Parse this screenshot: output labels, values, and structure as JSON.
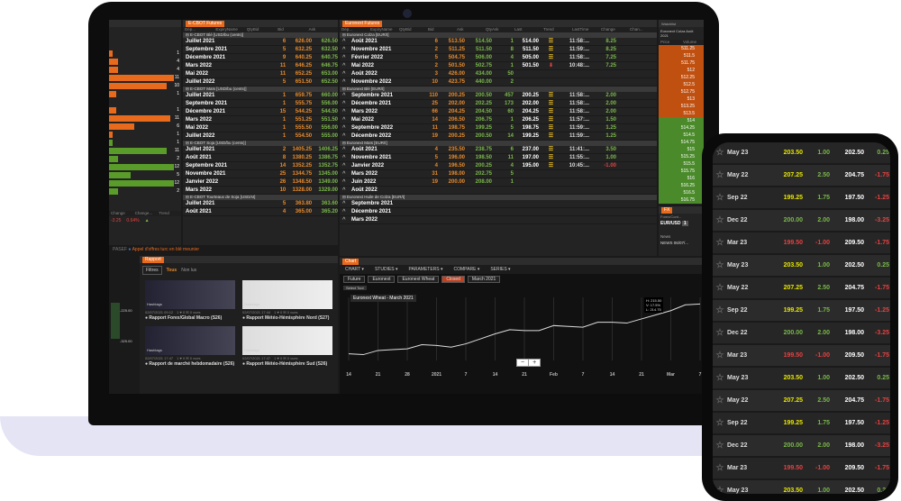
{
  "left_panel": {
    "bars": [
      {
        "value": "1",
        "fill": 0.05,
        "color": "#e86a1c"
      },
      {
        "value": "4",
        "fill": 0.12,
        "color": "#e86a1c"
      },
      {
        "value": "4",
        "fill": 0.12,
        "color": "#e86a1c"
      },
      {
        "value": "11",
        "fill": 0.9,
        "color": "#e86a1c"
      },
      {
        "value": "10",
        "fill": 0.8,
        "color": "#e86a1c"
      },
      {
        "value": "1",
        "fill": 0.1,
        "color": "#e86a1c"
      },
      {
        "value": "",
        "fill": 0,
        "color": "#e86a1c"
      },
      {
        "value": "1",
        "fill": 0.1,
        "color": "#e86a1c"
      },
      {
        "value": "11",
        "fill": 0.85,
        "color": "#e86a1c"
      },
      {
        "value": "6",
        "fill": 0.35,
        "color": "#e86a1c"
      },
      {
        "value": "1",
        "fill": 0.05,
        "color": "#e86a1c"
      },
      {
        "value": "1",
        "fill": 0.05,
        "color": "#5a9c2a"
      },
      {
        "value": "11",
        "fill": 0.8,
        "color": "#5a9c2a"
      },
      {
        "value": "2",
        "fill": 0.12,
        "color": "#5a9c2a"
      },
      {
        "value": "12",
        "fill": 0.9,
        "color": "#5a9c2a"
      },
      {
        "value": "5",
        "fill": 0.3,
        "color": "#5a9c2a"
      },
      {
        "value": "12",
        "fill": 0.9,
        "color": "#5a9c2a"
      },
      {
        "value": "2",
        "fill": 0.12,
        "color": "#5a9c2a"
      }
    ],
    "footer_headers": [
      "Change",
      "Change...",
      "Trend"
    ],
    "footer_values": [
      "-3.25",
      "0.64%"
    ]
  },
  "cbot": {
    "tab": "E-CBOT Futures",
    "headers": [
      "Dép...",
      "ExpiryName",
      "QtyBid",
      "Bid",
      "Ask"
    ],
    "sections": [
      {
        "title": "E-CBOT Blé [USD/bu (cents)]",
        "rows": [
          [
            "Juillet 2021",
            "6",
            "626.00",
            "626.50"
          ],
          [
            "Septembre 2021",
            "5",
            "632.25",
            "632.50"
          ],
          [
            "Décembre 2021",
            "9",
            "640.25",
            "640.75"
          ],
          [
            "Mars 2022",
            "11",
            "646.25",
            "646.75"
          ],
          [
            "Mai 2022",
            "11",
            "652.25",
            "653.00"
          ],
          [
            "Juillet 2022",
            "5",
            "651.50",
            "652.50"
          ]
        ]
      },
      {
        "title": "E-CBOT Maïs [USD/bu (cents)]",
        "rows": [
          [
            "Juillet 2021",
            "1",
            "659.75",
            "660.00"
          ],
          [
            "Septembre 2021",
            "1",
            "555.75",
            "556.00"
          ],
          [
            "Décembre 2021",
            "15",
            "544.25",
            "544.50"
          ],
          [
            "Mars 2022",
            "1",
            "551.25",
            "551.50"
          ],
          [
            "Mai 2022",
            "1",
            "555.50",
            "556.00"
          ],
          [
            "Juillet 2022",
            "1",
            "554.50",
            "555.00"
          ]
        ]
      },
      {
        "title": "E-CBOT Soja [USD/bu (cents)]",
        "rows": [
          [
            "Juillet 2021",
            "2",
            "1405.25",
            "1406.25"
          ],
          [
            "Août 2021",
            "8",
            "1380.25",
            "1386.75"
          ],
          [
            "Septembre 2021",
            "14",
            "1352.25",
            "1352.75"
          ],
          [
            "Novembre 2021",
            "25",
            "1344.75",
            "1345.00"
          ],
          [
            "Janvier 2022",
            "26",
            "1348.50",
            "1349.00"
          ],
          [
            "Mars 2022",
            "10",
            "1328.00",
            "1329.00"
          ]
        ]
      },
      {
        "title": "E-CBOT Tourteaux de Soja [USD/st]",
        "rows": [
          [
            "Juillet 2021",
            "5",
            "363.80",
            "363.60"
          ],
          [
            "Août 2021",
            "4",
            "365.00",
            "365.20"
          ]
        ]
      }
    ]
  },
  "euronext": {
    "tab": "Euronext Futures",
    "headers": [
      "Dép...",
      "ExpiryName",
      "QtyBid",
      "Bid",
      "Ask",
      "QtyAsk",
      "Last",
      "Trend",
      "LastTime",
      "Change",
      "Chan..."
    ],
    "sections": [
      {
        "title": "Euronext Colza [EUR/t]",
        "rows": [
          [
            "Août 2021",
            "6",
            "513.50",
            "514.50",
            "1",
            "514.00",
            "up",
            "11:58:...",
            "8.25",
            "1"
          ],
          [
            "Novembre 2021",
            "2",
            "511.25",
            "511.50",
            "8",
            "511.50",
            "up",
            "11:59:...",
            "8.25",
            "1"
          ],
          [
            "Février 2022",
            "5",
            "504.75",
            "506.00",
            "4",
            "505.00",
            "up",
            "11:58:...",
            "7.25",
            "1"
          ],
          [
            "Mai 2022",
            "2",
            "501.50",
            "502.75",
            "1",
            "501.50",
            "down",
            "10:48:...",
            "7.25",
            "1"
          ],
          [
            "Août 2022",
            "3",
            "426.00",
            "434.00",
            "50",
            "",
            "",
            "",
            "",
            ""
          ],
          [
            "Novembre 2022",
            "10",
            "423.75",
            "440.00",
            "2",
            "",
            "",
            "",
            "",
            ""
          ]
        ]
      },
      {
        "title": "Euronext Blé [EUR/t]",
        "rows": [
          [
            "Septembre 2021",
            "110",
            "200.25",
            "200.50",
            "457",
            "200.25",
            "up",
            "11:58:...",
            "2.00",
            "0"
          ],
          [
            "Décembre 2021",
            "25",
            "202.00",
            "202.25",
            "173",
            "202.00",
            "up",
            "11:58:...",
            "2.00",
            "0"
          ],
          [
            "Mars 2022",
            "66",
            "204.25",
            "204.50",
            "60",
            "204.25",
            "up",
            "11:58:...",
            "2.00",
            "0"
          ],
          [
            "Mai 2022",
            "14",
            "206.50",
            "206.75",
            "1",
            "206.25",
            "up",
            "11:57:...",
            "1.50",
            "0"
          ],
          [
            "Septembre 2022",
            "11",
            "198.75",
            "199.25",
            "5",
            "198.75",
            "up",
            "11:59:...",
            "1.25",
            "0"
          ],
          [
            "Décembre 2022",
            "19",
            "200.25",
            "200.50",
            "14",
            "199.25",
            "up",
            "11:59:...",
            "1.25",
            "0"
          ]
        ]
      },
      {
        "title": "Euronext Maïs [EUR/t]",
        "rows": [
          [
            "Août 2021",
            "4",
            "235.50",
            "238.75",
            "6",
            "237.00",
            "up",
            "11:41:...",
            "3.50",
            "1"
          ],
          [
            "Novembre 2021",
            "5",
            "196.00",
            "198.50",
            "11",
            "197.00",
            "up",
            "11:55:...",
            "1.00",
            "0"
          ],
          [
            "Janvier 2022",
            "4",
            "196.50",
            "200.25",
            "4",
            "195.00",
            "up",
            "10:45:...",
            "-1.00",
            "0"
          ],
          [
            "Mars 2022",
            "31",
            "198.00",
            "202.75",
            "5",
            "",
            "",
            "",
            "",
            ""
          ],
          [
            "Juin 2022",
            "19",
            "200.00",
            "208.00",
            "1",
            "",
            "",
            "",
            "",
            ""
          ],
          [
            "Août 2022",
            "",
            "",
            "",
            "",
            "",
            "",
            "",
            "",
            ""
          ]
        ]
      },
      {
        "title": "Euronext Huile de Colza [EUR/t]",
        "rows": [
          [
            "Septembre 2021",
            "",
            "",
            "",
            "",
            "",
            "",
            "",
            "",
            ""
          ],
          [
            "Décembre 2021",
            "",
            "",
            "",
            "",
            "",
            "",
            "",
            "",
            ""
          ],
          [
            "Mars 2022",
            "",
            "",
            "",
            "",
            "",
            "",
            "",
            "",
            ""
          ]
        ]
      }
    ]
  },
  "ladder": {
    "title": "Euronext Colza Août 2021",
    "headers": [
      "Price",
      "Volume"
    ],
    "ask": [
      "511.25",
      "511.5",
      "511.75",
      "512",
      "512.25",
      "512.5",
      "512.75",
      "513",
      "513.25",
      "513.5"
    ],
    "bid": [
      "514",
      "514.25",
      "514.5",
      "514.75",
      "515",
      "515.25",
      "515.5",
      "515.75",
      "516",
      "516.25",
      "516.5",
      "516.75"
    ]
  },
  "fx": {
    "tab": "FX",
    "headers": [
      "Forex/Cont...",
      ""
    ],
    "pair": "EUR/USD",
    "value": "1"
  },
  "news": {
    "label": "News",
    "source": "NEWS",
    "date": "06/07/..."
  },
  "ticker": {
    "prefix": "PASEF",
    "text": "Appel d'offres turc en blé meunier"
  },
  "rapport": {
    "tab": "Rapport",
    "filters_label": "Filtres",
    "filter_all": "Tous",
    "filter_unread": "Non lus",
    "cards": [
      {
        "title": "Rapport Forex/Global Macro (S26)",
        "date": "02/07/2021 09:12",
        "stats": "1 ♥ 0 ✉ 0 vues"
      },
      {
        "title": "Rapport Météo-Hémisphère Nord (S27)",
        "date": "02/07/2021 17:44",
        "stats": "1 ♥ 0 ✉ 0 vues"
      },
      {
        "title": "Rapport de marché hebdomadaire (S26)",
        "date": "02/07/2021 17:47",
        "stats": "1 ♥ 0 ✉ 0 vues"
      },
      {
        "title": "Rapport Météo-Hémisphère Sud (S26)",
        "date": "02/07/2021 17:47",
        "stats": "1 ♥ 0 ✉ 0 vues"
      }
    ],
    "tag": "Hashtags"
  },
  "mini_chart": {
    "labels": [
      "-225.00",
      "-325.00"
    ]
  },
  "chart": {
    "tab": "Chart",
    "toolbar": [
      "CHART",
      "STUDIES",
      "PARAMETERS",
      "COMPARE",
      "SERIES"
    ],
    "controls": [
      "Future",
      "Euronext",
      "Euronext Wheat",
      "Closed",
      "March 2021"
    ],
    "select_tool": "Select Tool",
    "series_label": "Euronext Wheat - March 2021",
    "tooltip": [
      "H: 215.50",
      "V: 17.5%",
      "L: 214.75"
    ],
    "x_ticks": [
      "14",
      "21",
      "28",
      "2021",
      "7",
      "14",
      "21",
      "Feb",
      "7",
      "14",
      "21",
      "Mar",
      "7"
    ],
    "zoom_minus": "−",
    "zoom_plus": "+",
    "chart_data": {
      "type": "line",
      "title": "Euronext Wheat - March 2021",
      "x": [
        "14",
        "21",
        "28",
        "2021",
        "7",
        "14",
        "21",
        "Feb",
        "7",
        "14",
        "21",
        "Mar",
        "7"
      ],
      "values": [
        184,
        186,
        187,
        189,
        190,
        196,
        198,
        201,
        200,
        203,
        205,
        210,
        214
      ],
      "ylim": [
        180,
        218
      ]
    }
  },
  "phone": {
    "rows": [
      [
        "May 23",
        "203.50",
        "1.00",
        "202.50",
        "0.25",
        "y",
        "gr",
        "gr"
      ],
      [
        "May 22",
        "207.25",
        "2.50",
        "204.75",
        "-1.75",
        "y",
        "gr",
        "rd"
      ],
      [
        "Sep 22",
        "199.25",
        "1.75",
        "197.50",
        "-1.25",
        "y",
        "gr",
        "rd"
      ],
      [
        "Dec 22",
        "200.00",
        "2.00",
        "198.00",
        "-3.25",
        "gr",
        "gr",
        "rd"
      ],
      [
        "Mar 23",
        "199.50",
        "-1.00",
        "209.50",
        "-1.75",
        "rd",
        "rd",
        "rd"
      ],
      [
        "May 23",
        "203.50",
        "1.00",
        "202.50",
        "0.25",
        "y",
        "gr",
        "gr"
      ],
      [
        "May 22",
        "207.25",
        "2.50",
        "204.75",
        "-1.75",
        "y",
        "gr",
        "rd"
      ],
      [
        "Sep 22",
        "199.25",
        "1.75",
        "197.50",
        "-1.25",
        "y",
        "gr",
        "rd"
      ],
      [
        "Dec 22",
        "200.00",
        "2.00",
        "198.00",
        "-3.25",
        "gr",
        "gr",
        "rd"
      ],
      [
        "Mar 23",
        "199.50",
        "-1.00",
        "209.50",
        "-1.75",
        "rd",
        "rd",
        "rd"
      ],
      [
        "May 23",
        "203.50",
        "1.00",
        "202.50",
        "0.25",
        "y",
        "gr",
        "gr"
      ],
      [
        "May 22",
        "207.25",
        "2.50",
        "204.75",
        "-1.75",
        "y",
        "gr",
        "rd"
      ],
      [
        "Sep 22",
        "199.25",
        "1.75",
        "197.50",
        "-1.25",
        "y",
        "gr",
        "rd"
      ],
      [
        "Dec 22",
        "200.00",
        "2.00",
        "198.00",
        "-3.25",
        "gr",
        "gr",
        "rd"
      ],
      [
        "Mar 23",
        "199.50",
        "-1.00",
        "209.50",
        "-1.75",
        "rd",
        "rd",
        "rd"
      ],
      [
        "May 23",
        "203.50",
        "1.00",
        "202.50",
        "0.25",
        "y",
        "gr",
        "gr"
      ],
      [
        "May 22",
        "207.25",
        "2.50",
        "204.75",
        "-1.75",
        "y",
        "gr",
        "rd"
      ]
    ]
  }
}
